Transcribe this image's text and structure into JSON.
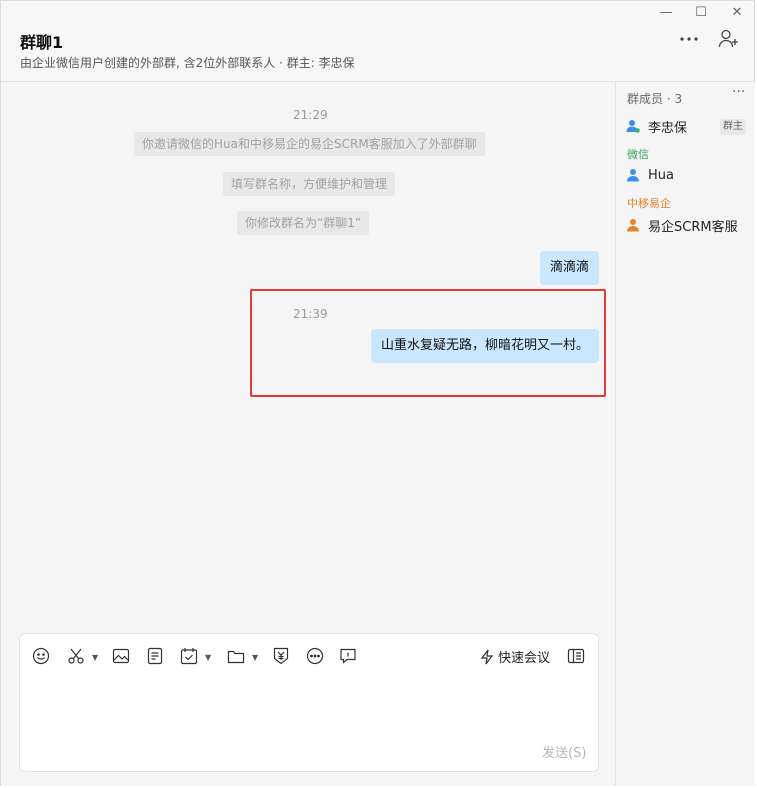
{
  "header": {
    "title": "群聊1",
    "subtitle": "由企业微信用户创建的外部群, 含2位外部联系人 · 群主: 李忠保",
    "more_icon": "more-dots-icon",
    "add_member_icon": "add-user-icon"
  },
  "window_controls": {
    "minimize": "—",
    "maximize": "☐",
    "close": "✕"
  },
  "chat": {
    "time1": "21:29",
    "system_messages": [
      "你邀请微信的Hua和中移易企的易企SCRM客服加入了外部群聊",
      "填写群名称，方便维护和管理",
      "你修改群名为“群聊1”"
    ],
    "message1": "滴滴滴",
    "time2": "21:39",
    "message2": "山重水复疑无路，柳暗花明又一村。"
  },
  "sidebar": {
    "title": "群成员 · 3",
    "more": "···",
    "owner_name": "李忠保",
    "owner_badge": "群主",
    "group_wechat_label": "微信",
    "wechat_member": "Hua",
    "group_company_label": "中移易企",
    "company_member": "易企SCRM客服"
  },
  "composer": {
    "quick_meeting": "快速会议",
    "send": "发送(S)"
  },
  "colors": {
    "bubble": "#c9e7ff",
    "highlight": "#e53935",
    "wechat_green": "#3aa35a",
    "company_orange": "#e8822a",
    "user_blue": "#3f8ee6"
  }
}
